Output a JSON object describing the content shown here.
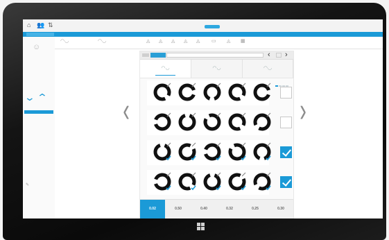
{
  "toolbar": {
    "icons": [
      {
        "name": "home-icon",
        "glyph": "⌂"
      },
      {
        "name": "people-icon",
        "glyph": "👥"
      },
      {
        "name": "transfer-icon",
        "glyph": "⇅"
      }
    ]
  },
  "ribbon": {
    "items": [
      {
        "glyph": "◠◡"
      },
      {
        "glyph": "◠◡"
      },
      {
        "glyph": "◬"
      },
      {
        "glyph": "◬"
      },
      {
        "glyph": "◬"
      },
      {
        "glyph": "◬"
      },
      {
        "glyph": "◬"
      },
      {
        "glyph": "▭"
      },
      {
        "glyph": "◬"
      },
      {
        "glyph": "▦"
      }
    ],
    "selected_index": 2
  },
  "panel": {
    "nav_prev": "‹",
    "nav_next": "›",
    "tabs": [
      {
        "glyph": "◠◡",
        "active": true
      },
      {
        "glyph": "◠◡",
        "active": false
      },
      {
        "glyph": "◠◡",
        "active": false
      }
    ],
    "rows": [
      {
        "checked": false,
        "gaps": [
          45,
          0,
          90,
          45,
          0
        ]
      },
      {
        "checked": false,
        "gaps": [
          180,
          270,
          225,
          45,
          135
        ]
      },
      {
        "checked": true,
        "gaps": [
          270,
          315,
          180,
          225,
          90
        ]
      },
      {
        "checked": true,
        "gaps": [
          180,
          45,
          270,
          315,
          135
        ]
      }
    ],
    "values": [
      {
        "label": "0.02",
        "selected": true
      },
      {
        "label": "0.50",
        "selected": false
      },
      {
        "label": "0.40",
        "selected": false
      },
      {
        "label": "0.32",
        "selected": false
      },
      {
        "label": "0.25",
        "selected": false
      },
      {
        "label": "0.30",
        "selected": false
      }
    ]
  },
  "big_nav": {
    "left": "‹",
    "right": "›"
  },
  "colors": {
    "accent": "#1b9ad7",
    "bezel": "#111111"
  }
}
